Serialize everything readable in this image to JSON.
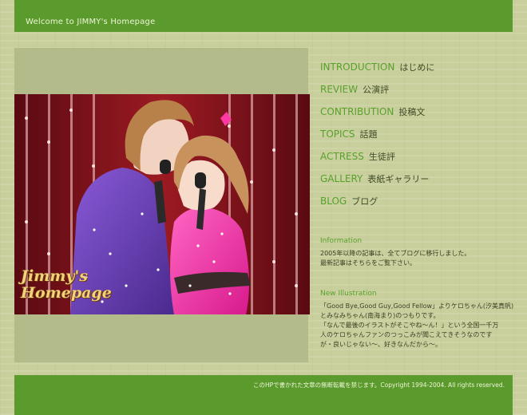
{
  "header": {
    "title": "Welcome to JIMMY's Homepage"
  },
  "hero": {
    "logo_line1": "Jimmy's",
    "logo_line2": "Homepage"
  },
  "nav": {
    "items": [
      {
        "en": "INTRODUCTION",
        "jp": "はじめに"
      },
      {
        "en": "REVIEW",
        "jp": "公演評"
      },
      {
        "en": "CONTRIBUTION",
        "jp": "投稿文"
      },
      {
        "en": "TOPICS",
        "jp": "話題"
      },
      {
        "en": "ACTRESS",
        "jp": "生徒評"
      },
      {
        "en": "GALLERY",
        "jp": "表紙ギャラリー"
      },
      {
        "en": "BLOG",
        "jp": "ブログ"
      }
    ]
  },
  "information": {
    "title": "Information",
    "lines": [
      "2005年以降の記事は、全てブログに移行しました。",
      "最新記事はそちらをご覧下さい。"
    ]
  },
  "new_illustration": {
    "title": "New Illustration",
    "lines": [
      "「Good Bye,Good Guy,Good Fellow」よりケロちゃん(汐美真帆)",
      "とみなみちゃん(南海まり)のつもりです。",
      "「なんで最後のイラストがそこやね～ん！」という全国一千万",
      "人のケロちゃんファンのつっこみが聞こえてきそうなのです",
      "が・良いじゃない～、好きなんだから～。"
    ]
  },
  "footer": {
    "text": "このHPで書かれた文章の無断転載を禁じます。Copyright 1994-2004. All rights reserved."
  }
}
